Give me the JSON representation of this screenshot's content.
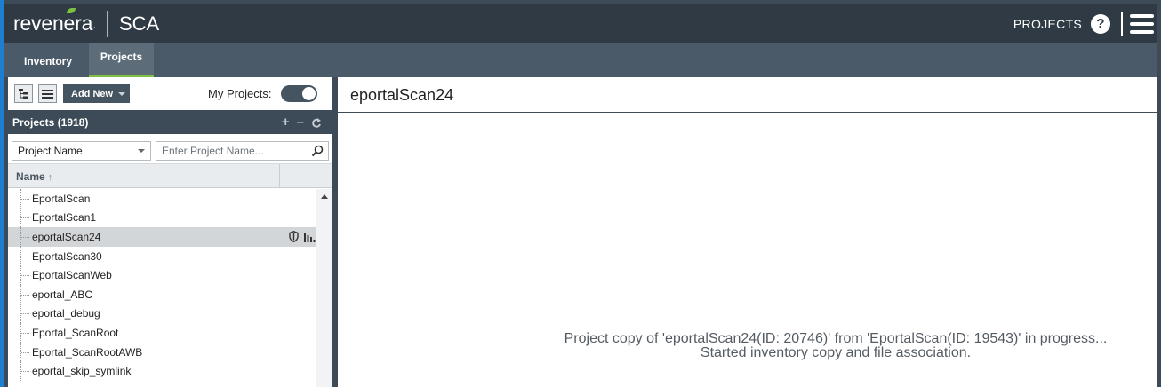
{
  "header": {
    "logo_text": "revenera",
    "logo_tm": ".",
    "product": "SCA",
    "projects_label": "PROJECTS",
    "help_label": "?"
  },
  "tabs": [
    {
      "label": "Inventory",
      "active": false
    },
    {
      "label": "Projects",
      "active": true
    }
  ],
  "toolbar": {
    "add_new_label": "Add New",
    "my_projects_label": "My Projects:",
    "my_projects_enabled": true
  },
  "projects_panel": {
    "title": "Projects (1918)",
    "filter_select_value": "Project Name",
    "search_placeholder": "Enter Project Name...",
    "column_header": "Name",
    "sort_arrow": "↑",
    "header_icons": [
      "plus-icon",
      "minus-icon",
      "refresh-icon"
    ],
    "items": [
      {
        "label": "EportalScan",
        "selected": false
      },
      {
        "label": "EportalScan1",
        "selected": false
      },
      {
        "label": "eportalScan24",
        "selected": true
      },
      {
        "label": "EportalScan30",
        "selected": false
      },
      {
        "label": "EportalScanWeb",
        "selected": false
      },
      {
        "label": "eportal_ABC",
        "selected": false
      },
      {
        "label": "eportal_debug",
        "selected": false
      },
      {
        "label": "Eportal_ScanRoot",
        "selected": false
      },
      {
        "label": "Eportal_ScanRootAWB",
        "selected": false
      },
      {
        "label": "eportal_skip_symlink",
        "selected": false
      }
    ]
  },
  "detail": {
    "title": "eportalScan24",
    "status_line1": "Project copy of 'eportalScan24(ID: 20746)' from 'EportalScan(ID: 19543)' in progress...",
    "status_line2": "Started inventory copy and file association."
  },
  "colors": {
    "header_bg": "#2f3a45",
    "tabs_bg": "#4b5a68",
    "active_tab_underline": "#7cc142",
    "accent_blue": "#1e7fd0",
    "selected_row": "#d3d6d9"
  }
}
